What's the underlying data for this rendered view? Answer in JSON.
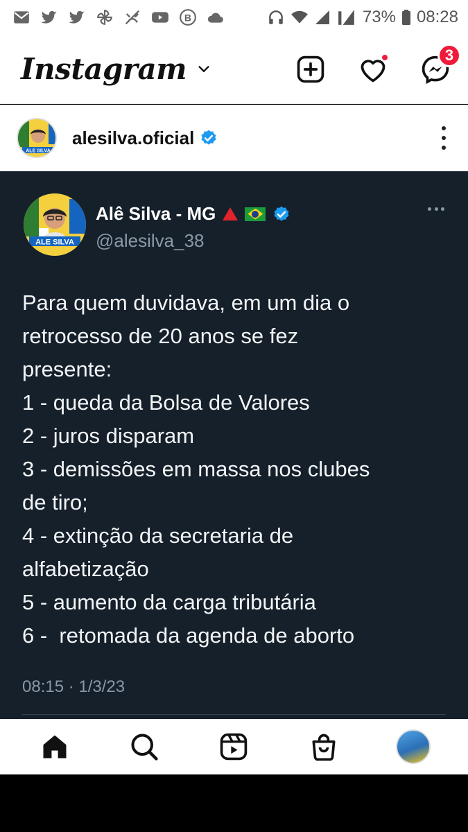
{
  "status_bar": {
    "battery": "73%",
    "time": "08:28",
    "left_icons": [
      "email-icon",
      "twitter-icon",
      "twitter-icon",
      "pinwheel-icon",
      "no-cat-icon",
      "youtube-icon",
      "b-icon",
      "cloud-icon"
    ],
    "right_icons": [
      "headset-icon",
      "wifi-icon",
      "signal-icon",
      "signal-icon",
      "battery-icon"
    ]
  },
  "header": {
    "logo": "Instagram",
    "badge_count": "3",
    "accent_color": "#ef1b3a"
  },
  "post": {
    "username": "alesilva.oficial",
    "verified_color": "#1d9bf0"
  },
  "tweet": {
    "name": "Alê Silva - MG",
    "handle": "@alesilva_38",
    "lines": [
      "Para quem duvidava, em um dia o",
      "retrocesso de 20 anos se fez",
      "presente:",
      "1 - queda da Bolsa de Valores",
      "2 - juros disparam",
      "3 - demissões em massa nos clubes",
      "de tiro;",
      "4 - extinção da secretaria de",
      "alfabetização",
      "5 - aumento da carga tributária",
      "6 -  retomada da agenda de aborto"
    ],
    "timestamp": "08:15 · 1/3/23",
    "background_color": "#15202b",
    "avatar_text": "ALE SILVA"
  },
  "bottom_nav": {
    "items": [
      "home-icon",
      "search-icon",
      "reels-icon",
      "shop-icon",
      "profile-avatar"
    ]
  }
}
